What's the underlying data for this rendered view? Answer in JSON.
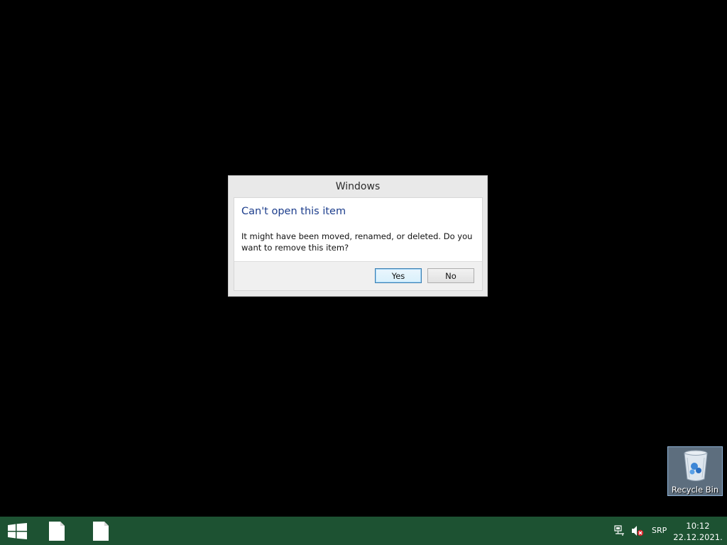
{
  "dialog": {
    "title": "Windows",
    "heading": "Can't open this item",
    "message": "It might have been moved, renamed, or deleted. Do you want to remove this item?",
    "yes_label": "Yes",
    "no_label": "No"
  },
  "desktop": {
    "recycle_bin_label": "Recycle Bin",
    "background_color": "#000000"
  },
  "taskbar": {
    "color": "#1d5232",
    "start_icon": "windows-logo-icon",
    "pinned": [
      {
        "icon": "file-icon"
      },
      {
        "icon": "file-icon"
      }
    ],
    "tray_icons": [
      "network-icon",
      "volume-muted-icon"
    ],
    "language": "SRP",
    "time": "10:12",
    "date": "22.12.2021."
  }
}
